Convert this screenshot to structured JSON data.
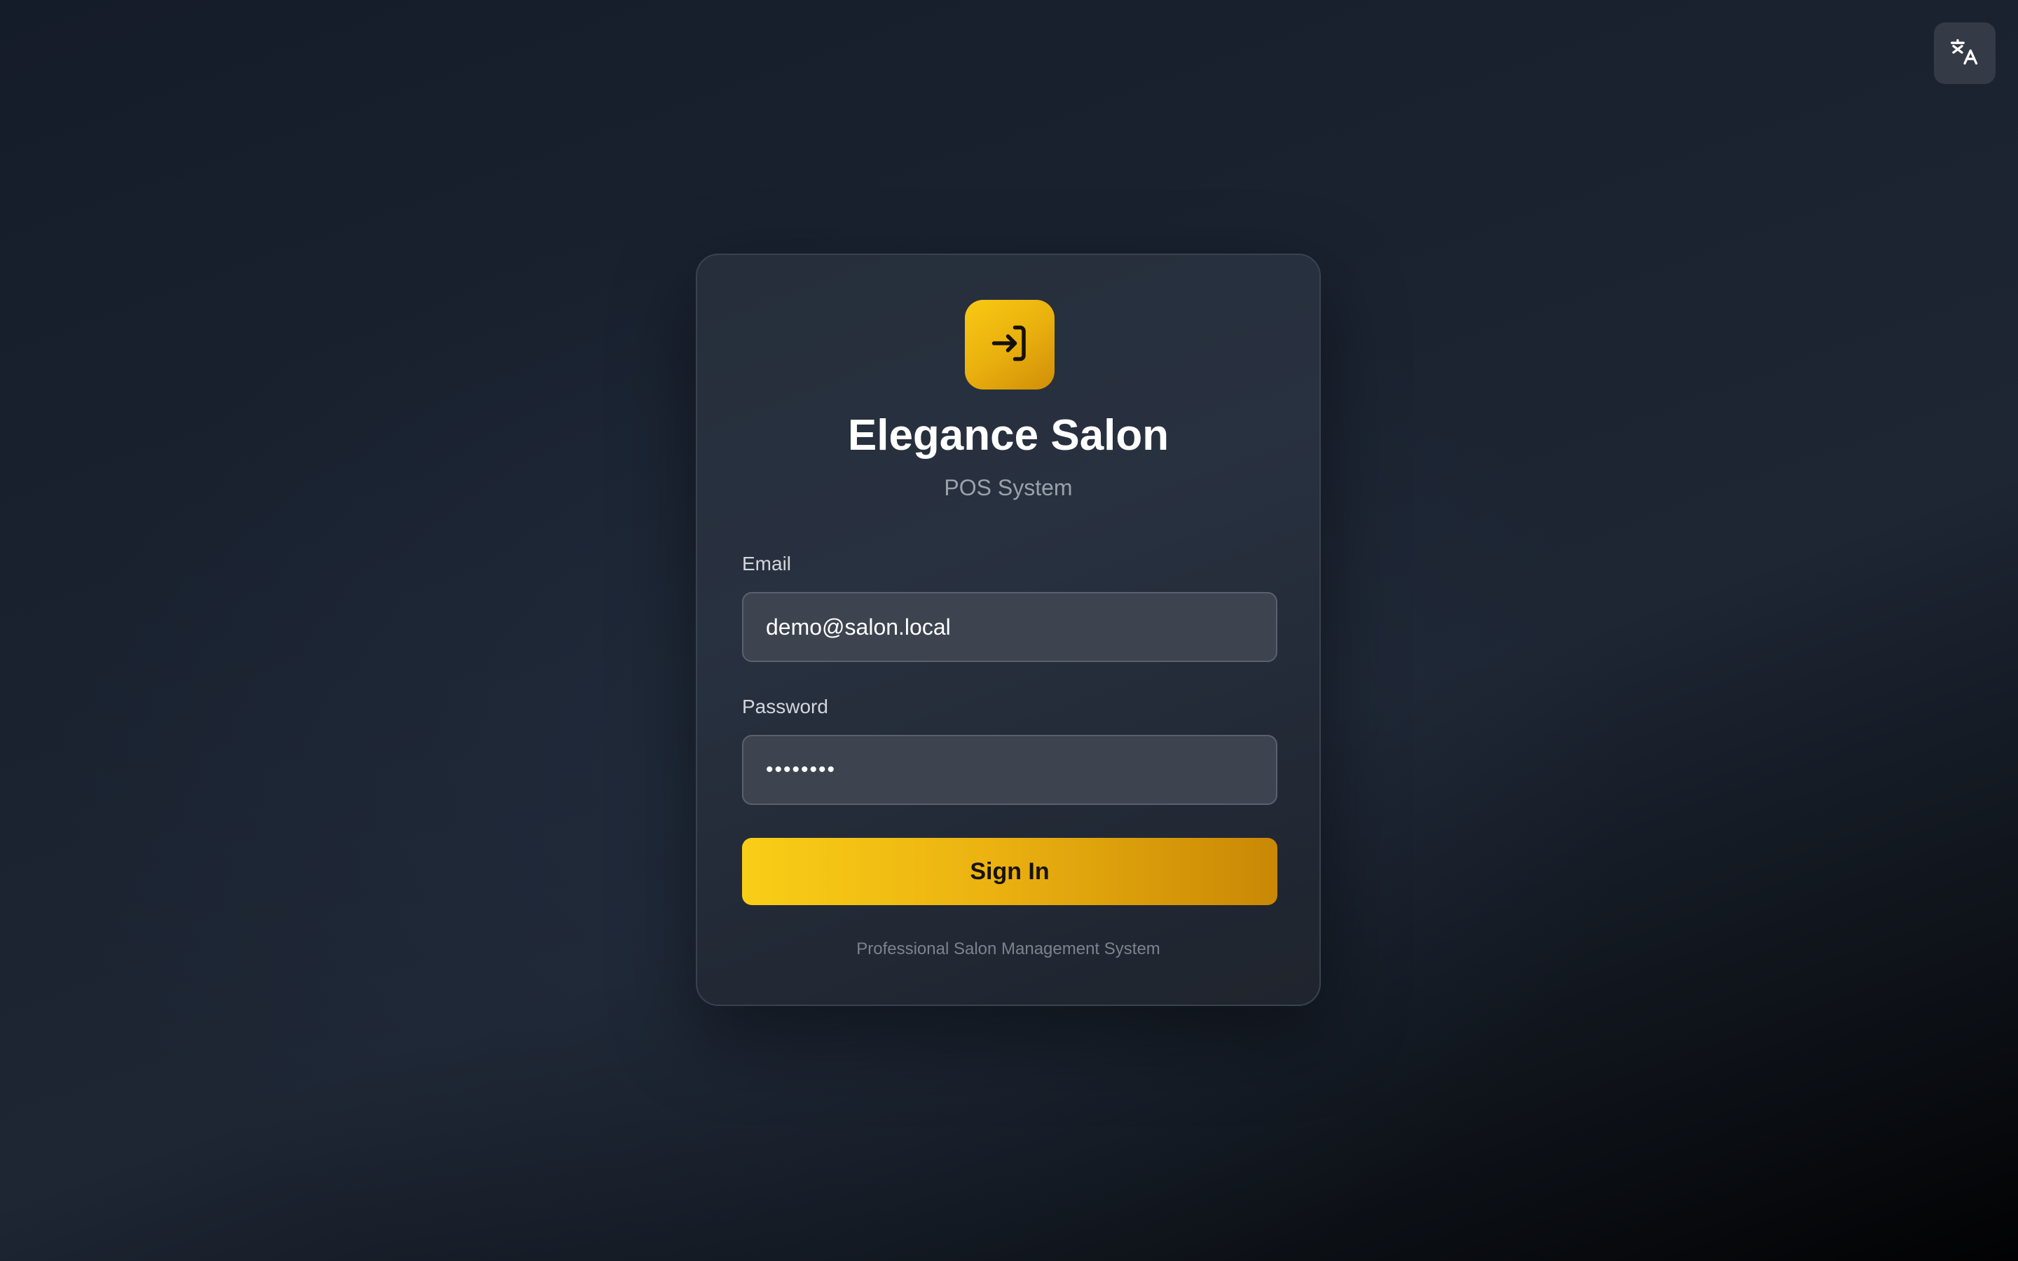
{
  "header": {
    "language_button_icon": "translate-icon"
  },
  "login": {
    "logo_icon": "sign-in-arrow-icon",
    "title": "Elegance Salon",
    "subtitle": "POS System",
    "email": {
      "label": "Email",
      "value": "demo@salon.local"
    },
    "password": {
      "label": "Password",
      "value": "••••••••"
    },
    "submit_label": "Sign In",
    "footer": "Professional Salon Management System"
  },
  "colors": {
    "accent": "#f5c211",
    "accent_dark": "#c98805",
    "card_background": "#262e3b",
    "page_background": "#151c29"
  }
}
